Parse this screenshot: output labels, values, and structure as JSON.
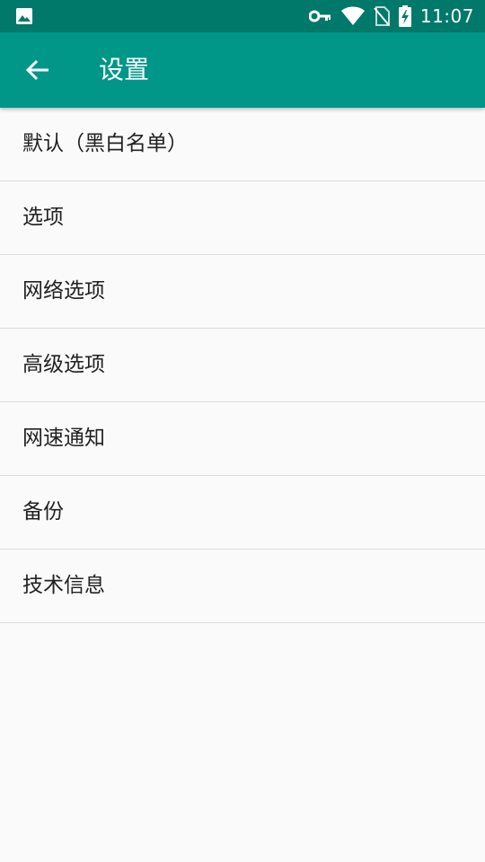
{
  "status_bar": {
    "time": "11:07",
    "icons": [
      "image-icon",
      "key-icon",
      "wifi-icon",
      "no-sim-icon",
      "battery-charging-icon"
    ]
  },
  "app_bar": {
    "title": "设置",
    "back_icon": "arrow-back-icon"
  },
  "colors": {
    "status_bar": "#00796b",
    "app_bar": "#009688",
    "background": "#fafafa",
    "divider": "#dcdcdc",
    "text": "#212121"
  },
  "settings": {
    "items": [
      {
        "label": "默认（黑白名单）"
      },
      {
        "label": "选项"
      },
      {
        "label": "网络选项"
      },
      {
        "label": "高级选项"
      },
      {
        "label": "网速通知"
      },
      {
        "label": "备份"
      },
      {
        "label": "技术信息"
      }
    ]
  }
}
